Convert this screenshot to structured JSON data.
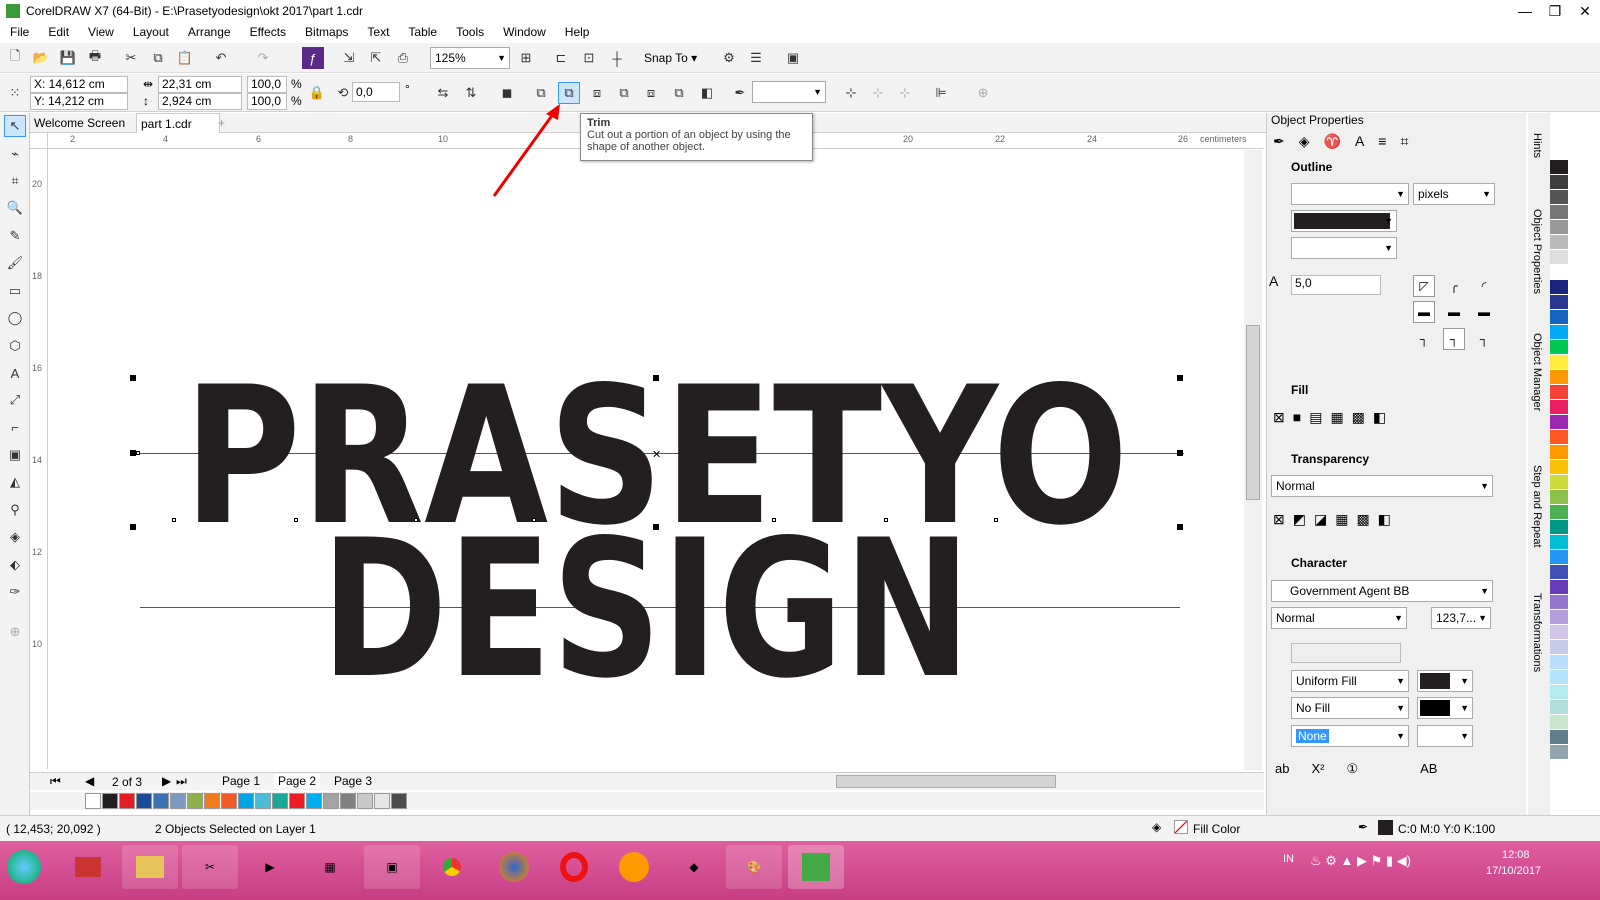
{
  "window": {
    "title": "CorelDRAW X7 (64-Bit) - E:\\Prasetyodesign\\okt 2017\\part 1.cdr"
  },
  "menu": [
    "File",
    "Edit",
    "View",
    "Layout",
    "Arrange",
    "Effects",
    "Bitmaps",
    "Text",
    "Table",
    "Tools",
    "Window",
    "Help"
  ],
  "toolbar": {
    "zoom": "125%",
    "snap_to": "Snap To"
  },
  "properties": {
    "x": "X: 14,612 cm",
    "y": "Y: 14,212 cm",
    "w": "22,31 cm",
    "h": "2,924 cm",
    "sx": "100,0",
    "sy": "100,0",
    "pct": "%",
    "rotation": "0,0",
    "deg": "°"
  },
  "tabs": {
    "welcome": "Welcome Screen",
    "doc": "part 1.cdr"
  },
  "tooltip": {
    "title": "Trim",
    "body": "Cut out a portion of an object by using the shape of another object."
  },
  "ruler": {
    "units": "centimeters",
    "h_ticks": [
      "2",
      "4",
      "6",
      "8",
      "10",
      "20",
      "22",
      "24",
      "26"
    ],
    "v_ticks": [
      "20",
      "18",
      "16",
      "14",
      "12",
      "10"
    ]
  },
  "artwork": {
    "line1": "PRASETYO",
    "line2": "DESIGN",
    "fill": "#231f20"
  },
  "pages": {
    "current": "2 of 3",
    "tabs": [
      "Page 1",
      "Page 2",
      "Page 3"
    ]
  },
  "status": {
    "coords": "( 12,453; 20,092 )",
    "selection": "2 Objects Selected on Layer 1",
    "fill_label": "Fill Color",
    "outline": "C:0 M:0 Y:0 K:100"
  },
  "panel": {
    "title": "Object Properties",
    "outline": {
      "heading": "Outline",
      "units": "pixels",
      "miter": "5,0",
      "color": "#231f20"
    },
    "fill": {
      "heading": "Fill"
    },
    "transparency": {
      "heading": "Transparency",
      "mode": "Normal"
    },
    "character": {
      "heading": "Character",
      "font": "Government Agent BB",
      "style": "Normal",
      "size": "123,7...",
      "fill_type": "Uniform Fill",
      "bg_fill": "No Fill",
      "outline": "None"
    }
  },
  "vtabs": [
    "Hints",
    "Object Properties",
    "Object Manager",
    "Step and Repeat",
    "Transformations"
  ],
  "palette_colors": [
    "#ffffff",
    "#231f20",
    "#e31e24",
    "#1e4a9a",
    "#3e70b4",
    "#7a9ac0",
    "#8fb04a",
    "#f07c1e",
    "#f15a24",
    "#00a4e4",
    "#4bbbd6",
    "#18a89a",
    "#ed1c24",
    "#00aeef",
    "#a3a3a3",
    "#808080",
    "#c8c8c8",
    "#e6e6e6",
    "#4d4d4d"
  ],
  "side_palette": [
    "#231f20",
    "#3d3d3d",
    "#555",
    "#777",
    "#999",
    "#bbb",
    "#ddd",
    "#fff",
    "#1a237e",
    "#283593",
    "#1565c0",
    "#03a9f4",
    "#00c853",
    "#ffeb3b",
    "#ff9800",
    "#f44336",
    "#e91e63",
    "#9c27b0",
    "#ff5722",
    "#ff9800",
    "#ffc107",
    "#cddc39",
    "#8bc34a",
    "#4caf50",
    "#009688",
    "#00bcd4",
    "#2196f3",
    "#3f51b5",
    "#673ab7",
    "#9575cd",
    "#b39ddb",
    "#d1c4e9",
    "#c5cae9",
    "#bbdefb",
    "#b3e5fc",
    "#b2ebf2",
    "#b2dfdb",
    "#c8e6c9",
    "#607d8b",
    "#90a4ae"
  ],
  "clock": {
    "time": "12:08",
    "date": "17/10/2017",
    "lang": "IN"
  }
}
